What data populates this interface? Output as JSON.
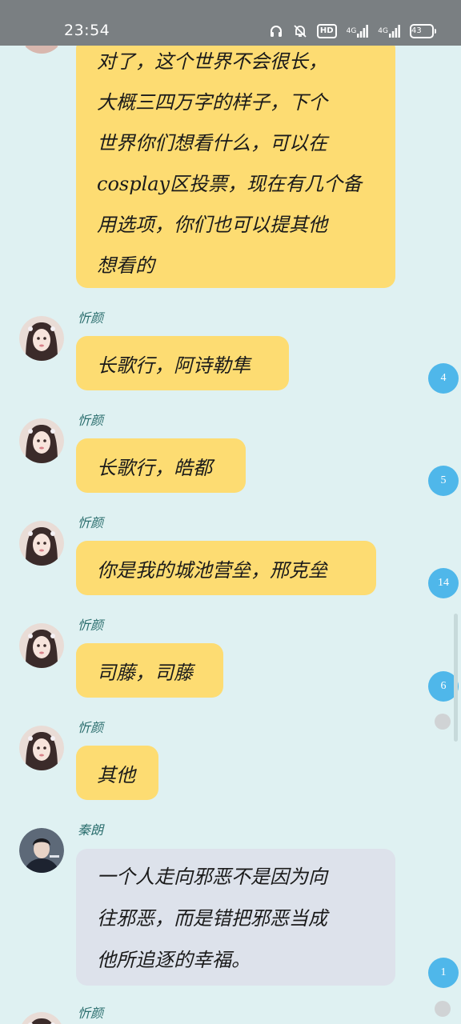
{
  "status_bar": {
    "time": "23:54",
    "hd_label": "HD",
    "net1_label": "4G",
    "net2_label": "4G",
    "battery_level": "43",
    "icons": [
      "headphones-icon",
      "bell-muted-icon",
      "hd-icon",
      "signal-4g-icon",
      "signal-4g-icon",
      "battery-icon"
    ]
  },
  "messages": [
    {
      "sender": "",
      "lines": [
        "对了，这个世界不会很长，",
        "大概三四万字的样子，下个",
        "世界你们想看什么，可以在",
        "cosplay区投票，现在有几个备",
        "用选项，你们也可以提其他",
        "想看的"
      ]
    },
    {
      "sender": "忻颜",
      "text": "长歌行，阿诗勒隼",
      "reaction_count": "4"
    },
    {
      "sender": "忻颜",
      "text": "长歌行，皓都",
      "reaction_count": "5"
    },
    {
      "sender": "忻颜",
      "text": "你是我的城池营垒，邢克垒",
      "reaction_count": "14"
    },
    {
      "sender": "忻颜",
      "text": "司藤，司藤",
      "reaction_count": "6"
    },
    {
      "sender": "忻颜",
      "text": "其他"
    },
    {
      "sender": "秦朗",
      "lines": [
        "一个人走向邪恶不是因为向",
        "往邪恶，而是错把邪恶当成",
        "他所追逐的幸福。"
      ],
      "reaction_count": "1"
    },
    {
      "sender": "忻颜"
    }
  ],
  "colors": {
    "background": "#dff1f2",
    "status_bar": "#7a7f82",
    "bubble_yellow": "#fddc72",
    "bubble_grey": "#dde2eb",
    "badge_blue": "#4fb7ea",
    "name_color": "#2b6e6e"
  }
}
